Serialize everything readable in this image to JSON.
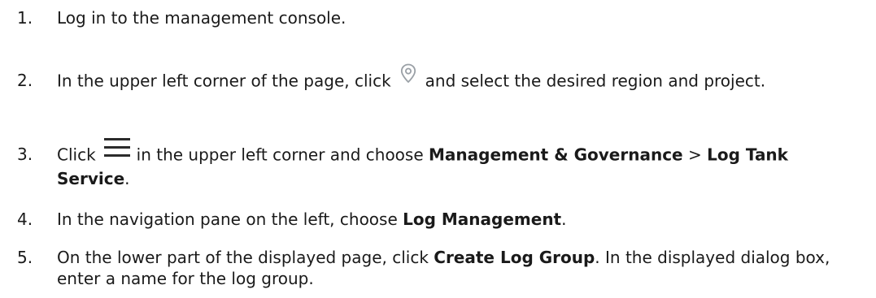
{
  "steps": [
    {
      "num": "1.",
      "text": "Log in to the management console."
    },
    {
      "num": "2.",
      "text_a": "In the upper left corner of the page, click",
      "icon": "location-pin-icon",
      "text_b": "and select the desired region and project."
    },
    {
      "num": "3.",
      "text_a": "Click",
      "icon": "hamburger-menu-icon",
      "text_b": "in the upper left corner and choose",
      "bold_1": "Management & Governance",
      "sep": ">",
      "bold_2": "Log Tank Service",
      "end": "."
    },
    {
      "num": "4.",
      "text_a": "In the navigation pane on the left, choose",
      "bold_1": "Log Management",
      "end": "."
    },
    {
      "num": "5.",
      "text_a": "On the lower part of the displayed page, click",
      "bold_1": "Create Log Group",
      "text_b": ". In the displayed dialog box, enter a name for the log group."
    }
  ],
  "colors": {
    "text": "#1a1a1a",
    "pin_icon": "#9aa0a6",
    "menu_icon": "#2b2b2b"
  }
}
